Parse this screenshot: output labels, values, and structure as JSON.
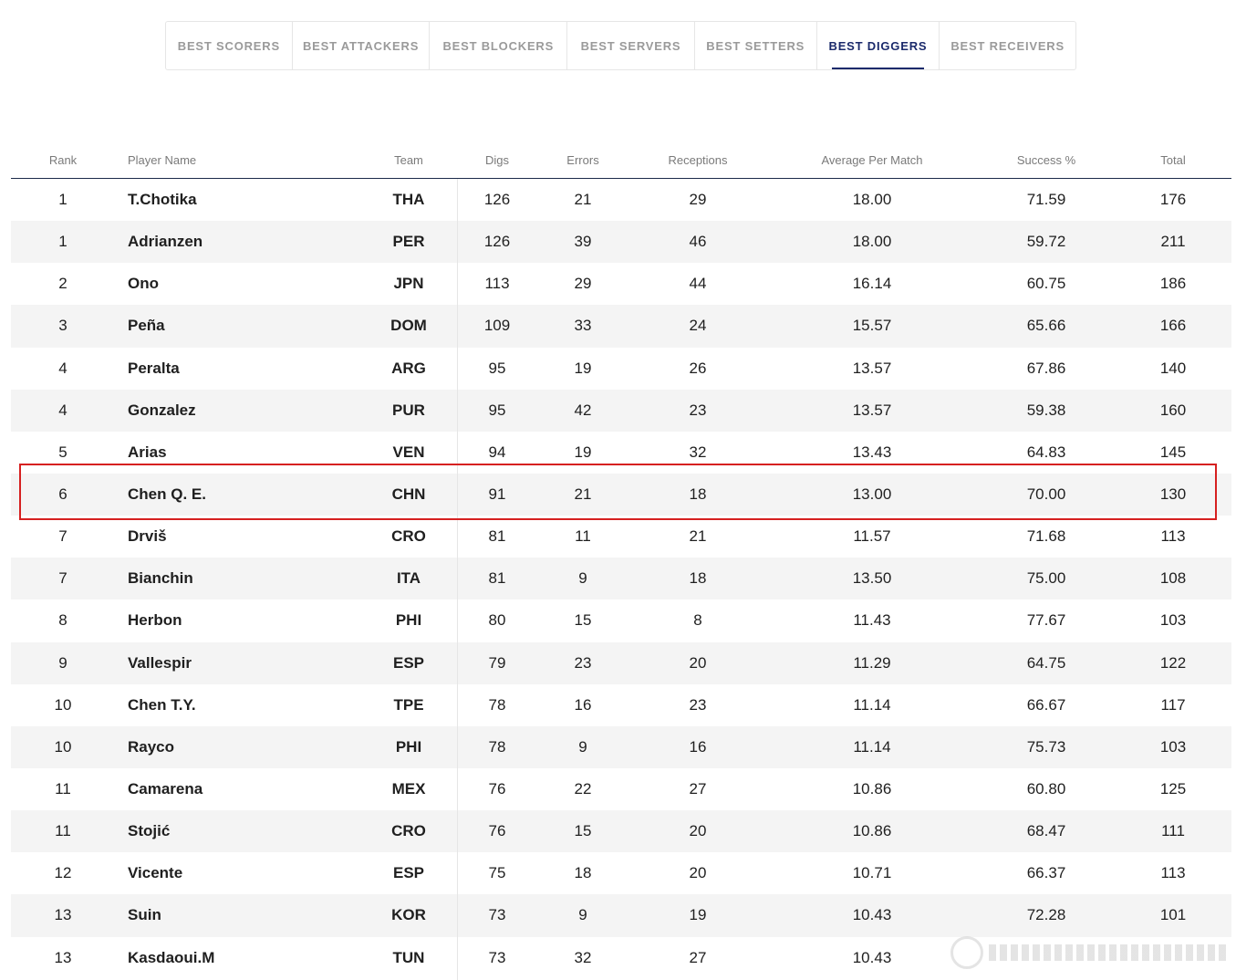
{
  "tabs": [
    {
      "label": "BEST SCORERS",
      "active": false
    },
    {
      "label": "BEST ATTACKERS",
      "active": false
    },
    {
      "label": "BEST BLOCKERS",
      "active": false
    },
    {
      "label": "BEST SERVERS",
      "active": false
    },
    {
      "label": "BEST SETTERS",
      "active": false
    },
    {
      "label": "BEST DIGGERS",
      "active": true
    },
    {
      "label": "BEST RECEIVERS",
      "active": false
    }
  ],
  "table": {
    "headers": {
      "rank": "Rank",
      "player": "Player Name",
      "team": "Team",
      "digs": "Digs",
      "errors": "Errors",
      "receptions": "Receptions",
      "avg": "Average Per Match",
      "success": "Success %",
      "total": "Total"
    },
    "rows": [
      {
        "rank": "1",
        "player": "T.Chotika",
        "team": "THA",
        "digs": "126",
        "errors": "21",
        "receptions": "29",
        "avg": "18.00",
        "success": "71.59",
        "total": "176"
      },
      {
        "rank": "1",
        "player": "Adrianzen",
        "team": "PER",
        "digs": "126",
        "errors": "39",
        "receptions": "46",
        "avg": "18.00",
        "success": "59.72",
        "total": "211"
      },
      {
        "rank": "2",
        "player": "Ono",
        "team": "JPN",
        "digs": "113",
        "errors": "29",
        "receptions": "44",
        "avg": "16.14",
        "success": "60.75",
        "total": "186"
      },
      {
        "rank": "3",
        "player": "Peña",
        "team": "DOM",
        "digs": "109",
        "errors": "33",
        "receptions": "24",
        "avg": "15.57",
        "success": "65.66",
        "total": "166"
      },
      {
        "rank": "4",
        "player": "Peralta",
        "team": "ARG",
        "digs": "95",
        "errors": "19",
        "receptions": "26",
        "avg": "13.57",
        "success": "67.86",
        "total": "140"
      },
      {
        "rank": "4",
        "player": "Gonzalez",
        "team": "PUR",
        "digs": "95",
        "errors": "42",
        "receptions": "23",
        "avg": "13.57",
        "success": "59.38",
        "total": "160"
      },
      {
        "rank": "5",
        "player": "Arias",
        "team": "VEN",
        "digs": "94",
        "errors": "19",
        "receptions": "32",
        "avg": "13.43",
        "success": "64.83",
        "total": "145"
      },
      {
        "rank": "6",
        "player": "Chen Q. E.",
        "team": "CHN",
        "digs": "91",
        "errors": "21",
        "receptions": "18",
        "avg": "13.00",
        "success": "70.00",
        "total": "130"
      },
      {
        "rank": "7",
        "player": "Drviš",
        "team": "CRO",
        "digs": "81",
        "errors": "11",
        "receptions": "21",
        "avg": "11.57",
        "success": "71.68",
        "total": "113"
      },
      {
        "rank": "7",
        "player": "Bianchin",
        "team": "ITA",
        "digs": "81",
        "errors": "9",
        "receptions": "18",
        "avg": "13.50",
        "success": "75.00",
        "total": "108"
      },
      {
        "rank": "8",
        "player": "Herbon",
        "team": "PHI",
        "digs": "80",
        "errors": "15",
        "receptions": "8",
        "avg": "11.43",
        "success": "77.67",
        "total": "103"
      },
      {
        "rank": "9",
        "player": "Vallespir",
        "team": "ESP",
        "digs": "79",
        "errors": "23",
        "receptions": "20",
        "avg": "11.29",
        "success": "64.75",
        "total": "122"
      },
      {
        "rank": "10",
        "player": "Chen T.Y.",
        "team": "TPE",
        "digs": "78",
        "errors": "16",
        "receptions": "23",
        "avg": "11.14",
        "success": "66.67",
        "total": "117"
      },
      {
        "rank": "10",
        "player": "Rayco",
        "team": "PHI",
        "digs": "78",
        "errors": "9",
        "receptions": "16",
        "avg": "11.14",
        "success": "75.73",
        "total": "103"
      },
      {
        "rank": "11",
        "player": "Camarena",
        "team": "MEX",
        "digs": "76",
        "errors": "22",
        "receptions": "27",
        "avg": "10.86",
        "success": "60.80",
        "total": "125"
      },
      {
        "rank": "11",
        "player": "Stojić",
        "team": "CRO",
        "digs": "76",
        "errors": "15",
        "receptions": "20",
        "avg": "10.86",
        "success": "68.47",
        "total": "111"
      },
      {
        "rank": "12",
        "player": "Vicente",
        "team": "ESP",
        "digs": "75",
        "errors": "18",
        "receptions": "20",
        "avg": "10.71",
        "success": "66.37",
        "total": "113"
      },
      {
        "rank": "13",
        "player": "Suin",
        "team": "KOR",
        "digs": "73",
        "errors": "9",
        "receptions": "19",
        "avg": "10.43",
        "success": "72.28",
        "total": "101"
      },
      {
        "rank": "13",
        "player": "Kasdaoui.M",
        "team": "TUN",
        "digs": "73",
        "errors": "32",
        "receptions": "27",
        "avg": "10.43",
        "success": "",
        "total": ""
      }
    ]
  },
  "highlighted_row": "Chen Q. E.",
  "colors": {
    "accent": "#1b2a6b",
    "highlight": "#d62020",
    "row_shade": "#f4f4f4"
  }
}
